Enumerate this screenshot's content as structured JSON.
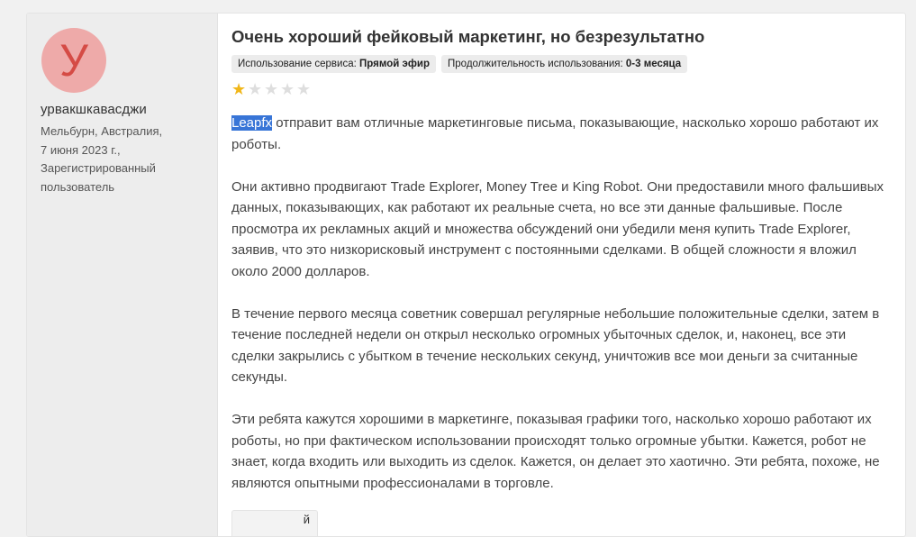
{
  "reviewer": {
    "avatar_letter": "У",
    "name": "урвакшкавасджи",
    "location": "Мельбурн, Австралия,",
    "date": "7 июня 2023 г.,",
    "status": "Зарегистрированный пользователь"
  },
  "review": {
    "title": "Очень хороший фейковый маркетинг, но безрезультатно",
    "tags": [
      {
        "label": "Использование сервиса:",
        "value": "Прямой эфир"
      },
      {
        "label": "Продолжительность использования:",
        "value": "0-3 месяца"
      }
    ],
    "rating": 1,
    "rating_max": 5,
    "highlighted_word": "Leapfx",
    "paragraph_1_rest": " отправит вам отличные маркетинговые письма, показывающие, насколько хорошо работают их роботы.",
    "paragraph_2": "Они активно продвигают Trade Explorer, Money Tree и King Robot. Они предоставили много фальшивых данных, показывающих, как работают их реальные счета, но все эти данные фальшивые. После просмотра их рекламных акций и множества обсуждений они убедили меня купить Trade Explorer, заявив, что это низкорисковый инструмент с постоянными сделками. В общей сложности я вложил около 2000 долларов.",
    "paragraph_3": "В течение первого месяца советник совершал регулярные небольшие положительные сделки, затем в течение последней недели он открыл несколько огромных убыточных сделок, и, наконец, все эти сделки закрылись с убытком в течение нескольких секунд, уничтожив все мои деньги за считанные секунды.",
    "paragraph_4": "Эти ребята кажутся хорошими в маркетинге, показывая графики того, насколько хорошо работают их роботы, но при фактическом использовании происходят только огромные убытки. Кажется, робот не знает, когда входить или выходить из сделок. Кажется, он делает это хаотично. Эти ребята, похоже, не являются опытными профессионалами в торговле.",
    "partial_button_label": "й"
  },
  "colors": {
    "star_on": "#f1b71a",
    "star_off": "#dedede",
    "selection": "#3875d7",
    "avatar_bg": "#eeaaa9",
    "avatar_fg": "#d54b45"
  }
}
